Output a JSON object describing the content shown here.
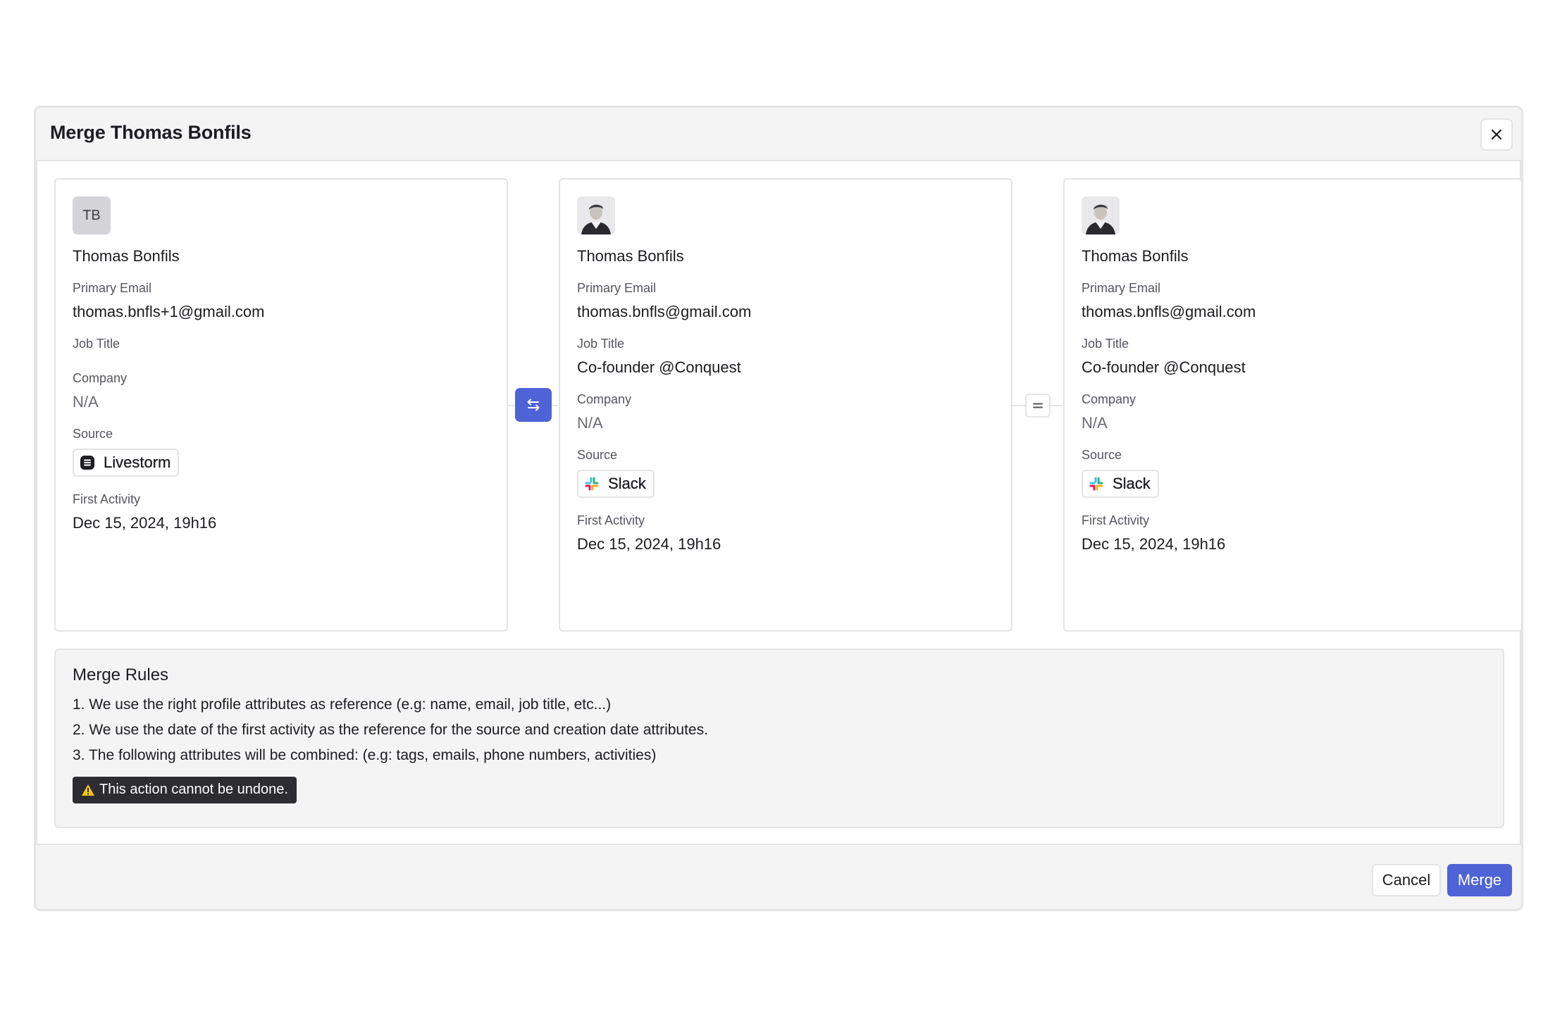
{
  "dialog": {
    "title": "Merge Thomas Bonfils",
    "close_icon": "close-icon"
  },
  "profiles": [
    {
      "avatar_initials": "TB",
      "name": "Thomas Bonfils",
      "primary_email_label": "Primary Email",
      "primary_email": "thomas.bnfls+1@gmail.com",
      "job_title_label": "Job Title",
      "job_title": "",
      "company_label": "Company",
      "company": "N/A",
      "source_label": "Source",
      "source": "Livestorm",
      "source_icon": "livestorm-icon",
      "first_activity_label": "First Activity",
      "first_activity": "Dec 15, 2024, 19h16"
    },
    {
      "avatar_initials": "",
      "name": "Thomas Bonfils",
      "primary_email_label": "Primary Email",
      "primary_email": "thomas.bnfls@gmail.com",
      "job_title_label": "Job Title",
      "job_title": "Co-founder @Conquest",
      "company_label": "Company",
      "company": "N/A",
      "source_label": "Source",
      "source": "Slack",
      "source_icon": "slack-icon",
      "first_activity_label": "First Activity",
      "first_activity": "Dec 15, 2024, 19h16"
    },
    {
      "avatar_initials": "",
      "name": "Thomas Bonfils",
      "primary_email_label": "Primary Email",
      "primary_email": "thomas.bnfls@gmail.com",
      "job_title_label": "Job Title",
      "job_title": "Co-founder @Conquest",
      "company_label": "Company",
      "company": "N/A",
      "source_label": "Source",
      "source": "Slack",
      "source_icon": "slack-icon",
      "first_activity_label": "First Activity",
      "first_activity": "Dec 15, 2024, 19h16"
    }
  ],
  "connectors": {
    "swap_icon": "swap-arrows-icon",
    "equals_icon": "equals-icon"
  },
  "merge_rules": {
    "title": "Merge Rules",
    "rules": [
      "1. We use the right profile attributes as reference (e.g: name, email, job title, etc...)",
      "2. We use the date of the first activity as the reference for the source and creation date attributes.",
      "3. The following attributes will be combined: (e.g: tags, emails, phone numbers, activities)"
    ],
    "warning_icon": "warning-icon",
    "warning": "This action cannot be undone."
  },
  "footer": {
    "cancel_label": "Cancel",
    "merge_label": "Merge"
  },
  "colors": {
    "accent": "#4e63d6",
    "warning_bg": "#2c2c31",
    "warning_icon": "#f5c518"
  }
}
